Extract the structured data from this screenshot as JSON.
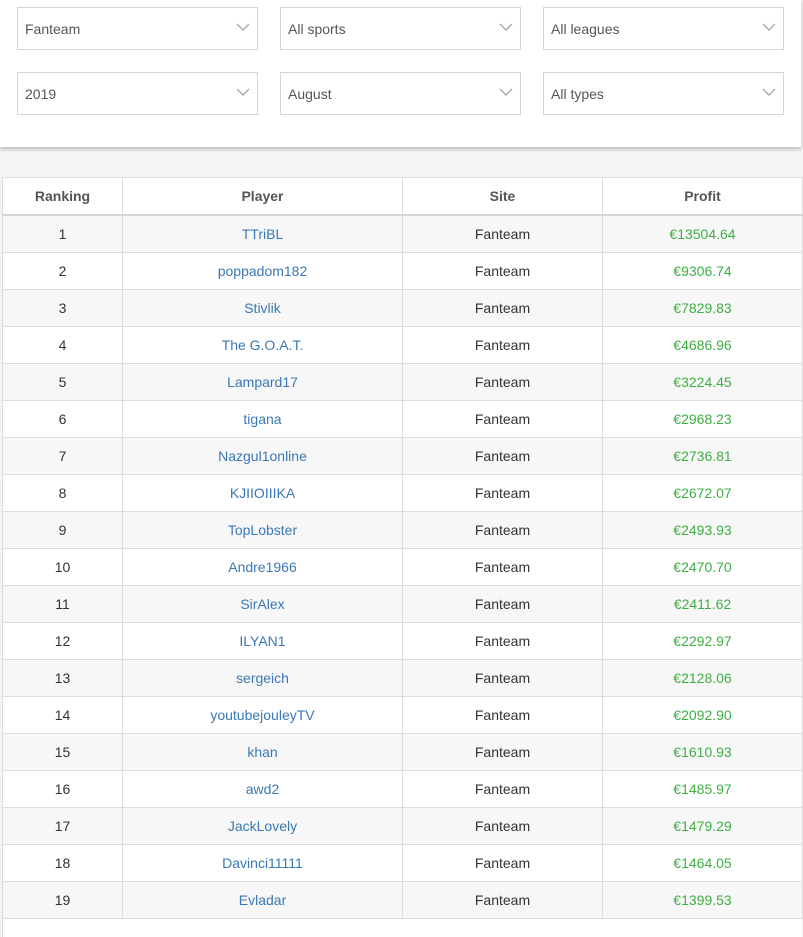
{
  "filters": {
    "site": "Fanteam",
    "sport": "All sports",
    "league": "All leagues",
    "year": "2019",
    "month": "August",
    "type": "All types"
  },
  "table": {
    "headers": {
      "ranking": "Ranking",
      "player": "Player",
      "site": "Site",
      "profit": "Profit"
    },
    "rows": [
      {
        "rank": "1",
        "player": "TTriBL",
        "site": "Fanteam",
        "profit": "€13504.64"
      },
      {
        "rank": "2",
        "player": "poppadom182",
        "site": "Fanteam",
        "profit": "€9306.74"
      },
      {
        "rank": "3",
        "player": "Stivlik",
        "site": "Fanteam",
        "profit": "€7829.83"
      },
      {
        "rank": "4",
        "player": "The G.O.A.T.",
        "site": "Fanteam",
        "profit": "€4686.96"
      },
      {
        "rank": "5",
        "player": "Lampard17",
        "site": "Fanteam",
        "profit": "€3224.45"
      },
      {
        "rank": "6",
        "player": "tigana",
        "site": "Fanteam",
        "profit": "€2968.23"
      },
      {
        "rank": "7",
        "player": "Nazgul1online",
        "site": "Fanteam",
        "profit": "€2736.81"
      },
      {
        "rank": "8",
        "player": "KJIIOIIIKA",
        "site": "Fanteam",
        "profit": "€2672.07"
      },
      {
        "rank": "9",
        "player": "TopLobster",
        "site": "Fanteam",
        "profit": "€2493.93"
      },
      {
        "rank": "10",
        "player": "Andre1966",
        "site": "Fanteam",
        "profit": "€2470.70"
      },
      {
        "rank": "11",
        "player": "SirAlex",
        "site": "Fanteam",
        "profit": "€2411.62"
      },
      {
        "rank": "12",
        "player": "ILYAN1",
        "site": "Fanteam",
        "profit": "€2292.97"
      },
      {
        "rank": "13",
        "player": "sergeich",
        "site": "Fanteam",
        "profit": "€2128.06"
      },
      {
        "rank": "14",
        "player": "youtubejouleyTV",
        "site": "Fanteam",
        "profit": "€2092.90"
      },
      {
        "rank": "15",
        "player": "khan",
        "site": "Fanteam",
        "profit": "€1610.93"
      },
      {
        "rank": "16",
        "player": "awd2",
        "site": "Fanteam",
        "profit": "€1485.97"
      },
      {
        "rank": "17",
        "player": "JackLovely",
        "site": "Fanteam",
        "profit": "€1479.29"
      },
      {
        "rank": "18",
        "player": "Davinci11111",
        "site": "Fanteam",
        "profit": "€1464.05"
      },
      {
        "rank": "19",
        "player": "Evladar",
        "site": "Fanteam",
        "profit": "€1399.53"
      }
    ]
  },
  "colors": {
    "player_link": "#3a78b5",
    "profit_positive": "#3fae44"
  },
  "icons": {
    "dropdown": "chevron-down-icon"
  }
}
